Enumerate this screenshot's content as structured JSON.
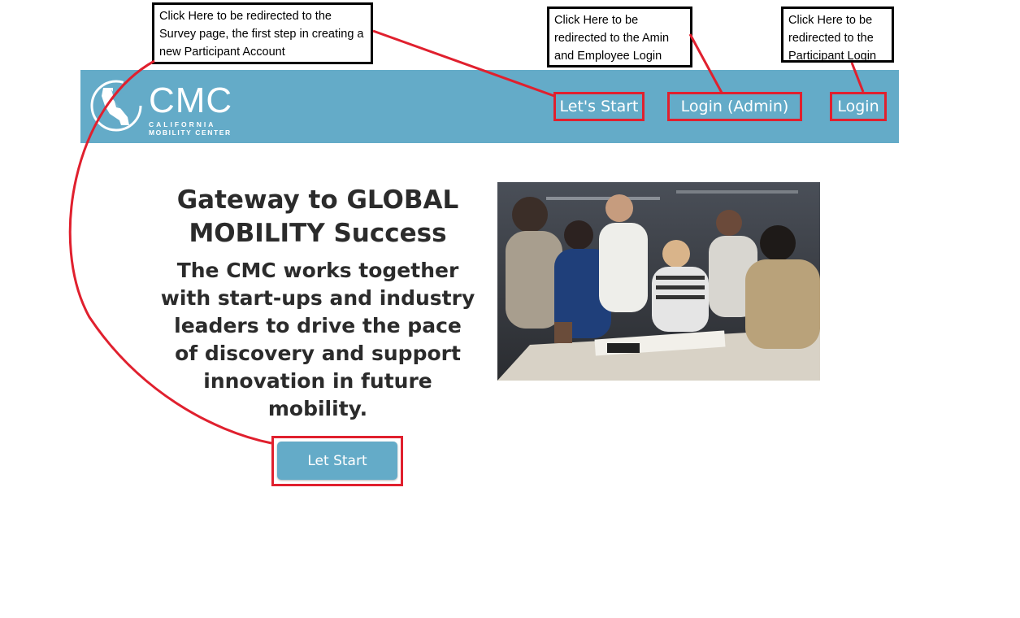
{
  "annotations": {
    "survey_note": "Click Here to be redirected to the Survey page, the first step in creating a new Participant Account",
    "admin_note": "Click Here to be redirected to the Amin and Employee Login",
    "participant_note": "Click Here to be redirected to the Participant Login"
  },
  "navbar": {
    "logo": {
      "wordmark": "CMC",
      "line1": "CALIFORNIA",
      "line2": "MOBILITY CENTER"
    },
    "links": {
      "lets_start": "Let's Start",
      "login_admin": "Login (Admin)",
      "login": "Login"
    }
  },
  "hero": {
    "title": "Gateway to GLOBAL MOBILITY Success",
    "body": "The CMC works together with start-ups and industry leaders to drive the pace of discovery and support innovation in future mobility.",
    "cta_label": "Let Start"
  },
  "colors": {
    "navbar_bg": "#64abc8",
    "annotation_red": "#e0202e",
    "text_dark": "#2b2b2b"
  }
}
